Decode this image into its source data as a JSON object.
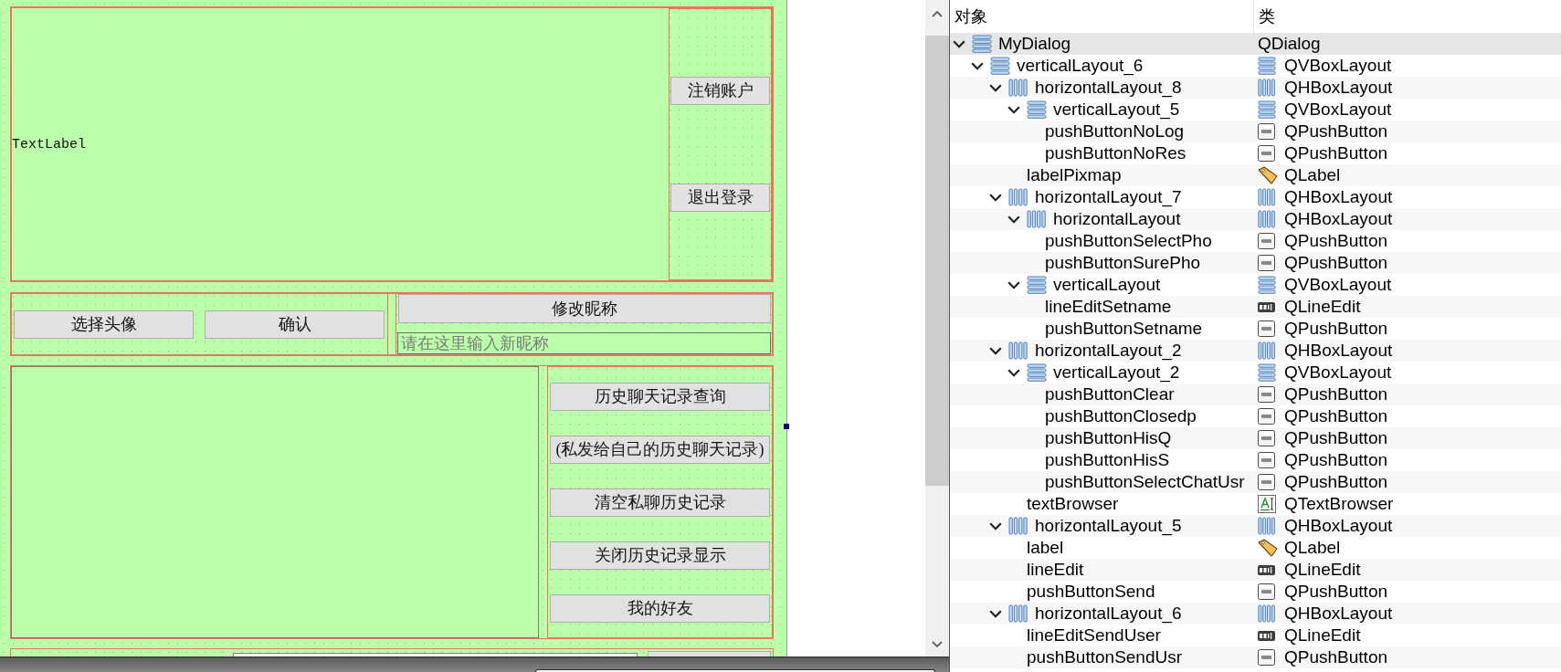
{
  "form": {
    "top": {
      "label": "TextLabel",
      "buttons": [
        "注销账户",
        "退出登录"
      ]
    },
    "avatar_row": {
      "buttons": [
        "选择头像",
        "确认"
      ],
      "nickname_button": "修改昵称",
      "nickname_field": {
        "placeholder": "请在这里输入新昵称"
      }
    },
    "history": {
      "buttons": [
        "历史聊天记录查询",
        "(私发给自己的历史聊天记录)",
        "清空私聊历史记录",
        "关闭历史记录显示",
        "我的好友"
      ]
    }
  },
  "object_tree": {
    "columns": [
      "对象",
      "类"
    ],
    "rows": [
      {
        "name": "MyDialog",
        "class": "QDialog",
        "kind": "dialog",
        "expanded": true,
        "selected": true,
        "children": [
          {
            "name": "verticalLayout_6",
            "class": "QVBoxLayout",
            "kind": "vertical_layout",
            "expanded": true,
            "selected": false,
            "children": [
              {
                "name": "horizontalLayout_8",
                "class": "QHBoxLayout",
                "kind": "horizontal_layout",
                "expanded": true,
                "selected": false,
                "children": [
                  {
                    "name": "verticalLayout_5",
                    "class": "QVBoxLayout",
                    "kind": "vertical_layout",
                    "expanded": true,
                    "selected": false,
                    "children": [
                      {
                        "name": "pushButtonNoLog",
                        "class": "QPushButton",
                        "kind": "push_button",
                        "selected": false
                      },
                      {
                        "name": "pushButtonNoRes",
                        "class": "QPushButton",
                        "kind": "push_button",
                        "selected": false
                      }
                    ]
                  },
                  {
                    "name": "labelPixmap",
                    "class": "QLabel",
                    "kind": "label",
                    "selected": false
                  }
                ]
              },
              {
                "name": "horizontalLayout_7",
                "class": "QHBoxLayout",
                "kind": "horizontal_layout",
                "expanded": true,
                "selected": false,
                "children": [
                  {
                    "name": "horizontalLayout",
                    "class": "QHBoxLayout",
                    "kind": "horizontal_layout",
                    "expanded": true,
                    "selected": false,
                    "children": [
                      {
                        "name": "pushButtonSelectPho",
                        "class": "QPushButton",
                        "kind": "push_button",
                        "selected": false
                      },
                      {
                        "name": "pushButtonSurePho",
                        "class": "QPushButton",
                        "kind": "push_button",
                        "selected": false
                      }
                    ]
                  },
                  {
                    "name": "verticalLayout",
                    "class": "QVBoxLayout",
                    "kind": "vertical_layout",
                    "expanded": true,
                    "selected": false,
                    "children": [
                      {
                        "name": "lineEditSetname",
                        "class": "QLineEdit",
                        "kind": "line_edit",
                        "selected": false
                      },
                      {
                        "name": "pushButtonSetname",
                        "class": "QPushButton",
                        "kind": "push_button",
                        "selected": false
                      }
                    ]
                  }
                ]
              },
              {
                "name": "horizontalLayout_2",
                "class": "QHBoxLayout",
                "kind": "horizontal_layout",
                "expanded": true,
                "selected": false,
                "children": [
                  {
                    "name": "verticalLayout_2",
                    "class": "QVBoxLayout",
                    "kind": "vertical_layout",
                    "expanded": true,
                    "selected": false,
                    "children": [
                      {
                        "name": "pushButtonClear",
                        "class": "QPushButton",
                        "kind": "push_button",
                        "selected": false
                      },
                      {
                        "name": "pushButtonClosedp",
                        "class": "QPushButton",
                        "kind": "push_button",
                        "selected": false
                      },
                      {
                        "name": "pushButtonHisQ",
                        "class": "QPushButton",
                        "kind": "push_button",
                        "selected": false
                      },
                      {
                        "name": "pushButtonHisS",
                        "class": "QPushButton",
                        "kind": "push_button",
                        "selected": false
                      },
                      {
                        "name": "pushButtonSelectChatUsr",
                        "class": "QPushButton",
                        "kind": "push_button",
                        "selected": false
                      }
                    ]
                  },
                  {
                    "name": "textBrowser",
                    "class": "QTextBrowser",
                    "kind": "text_browser",
                    "selected": false
                  }
                ]
              },
              {
                "name": "horizontalLayout_5",
                "class": "QHBoxLayout",
                "kind": "horizontal_layout",
                "expanded": true,
                "selected": false,
                "children": [
                  {
                    "name": "label",
                    "class": "QLabel",
                    "kind": "label",
                    "selected": false
                  },
                  {
                    "name": "lineEdit",
                    "class": "QLineEdit",
                    "kind": "line_edit",
                    "selected": false
                  },
                  {
                    "name": "pushButtonSend",
                    "class": "QPushButton",
                    "kind": "push_button",
                    "selected": false
                  }
                ]
              },
              {
                "name": "horizontalLayout_6",
                "class": "QHBoxLayout",
                "kind": "horizontal_layout",
                "expanded": true,
                "selected": false,
                "children": [
                  {
                    "name": "lineEditSendUser",
                    "class": "QLineEdit",
                    "kind": "line_edit",
                    "selected": false
                  },
                  {
                    "name": "pushButtonSendUsr",
                    "class": "QPushButton",
                    "kind": "push_button",
                    "selected": false
                  }
                ]
              }
            ]
          }
        ]
      }
    ]
  }
}
